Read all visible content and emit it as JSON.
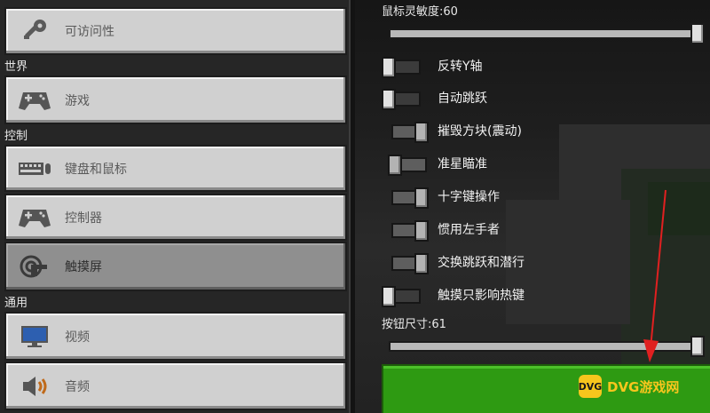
{
  "sidebar": {
    "accessibility_label": "可访问性",
    "world_section": "世界",
    "game_label": "游戏",
    "controls_section": "控制",
    "keyboard_mouse_label": "键盘和鼠标",
    "controller_label": "控制器",
    "touchscreen_label": "触摸屏",
    "general_section": "通用",
    "video_label": "视频",
    "audio_label": "音频"
  },
  "panel": {
    "mouse_sensitivity_label": "鼠标灵敏度:60",
    "mouse_sensitivity_value": 1.0,
    "toggles": [
      {
        "label": "反转Y轴",
        "on": false,
        "enabled": true
      },
      {
        "label": "自动跳跃",
        "on": false,
        "enabled": true
      },
      {
        "label": "摧毁方块(震动)",
        "on": true,
        "enabled": false
      },
      {
        "label": "准星瞄准",
        "on": false,
        "enabled": false
      },
      {
        "label": "十字键操作",
        "on": true,
        "enabled": false
      },
      {
        "label": "惯用左手者",
        "on": true,
        "enabled": false
      },
      {
        "label": "交换跳跃和潜行",
        "on": true,
        "enabled": false
      },
      {
        "label": "触摸只影响热键",
        "on": false,
        "enabled": true
      }
    ],
    "button_size_label": "按钮尺寸:61",
    "button_size_value": 1.0
  },
  "watermark": {
    "logo_text": "DVG",
    "text": "DVG游戏网"
  },
  "colors": {
    "done_button": "#2e9a12",
    "selected_nav": "#8f8f8f",
    "annotation_arrow": "#e02020"
  }
}
